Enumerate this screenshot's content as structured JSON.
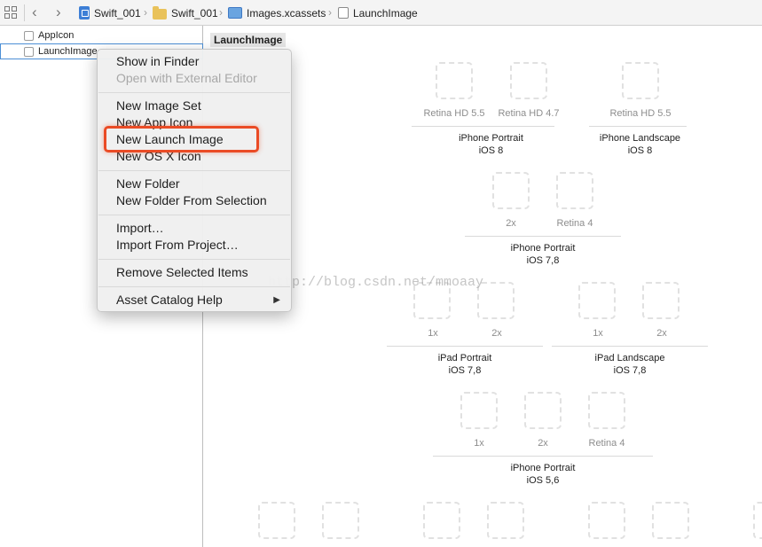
{
  "jumpbar": {
    "crumbs": [
      "Swift_001",
      "Swift_001",
      "Images.xcassets",
      "LaunchImage"
    ],
    "icons": [
      "grid-icon",
      "back-arrow-icon",
      "forward-arrow-icon",
      "project-file-icon",
      "folder-icon",
      "asset-catalog-icon",
      "launch-image-icon"
    ]
  },
  "outline": {
    "items": [
      "AppIcon",
      "LaunchImage"
    ]
  },
  "main": {
    "set_title": "LaunchImage",
    "slots": [
      "Retina HD 5.5",
      "Retina HD 4.7",
      "Retina HD 5.5",
      "2x",
      "Retina 4",
      "1x",
      "2x",
      "1x",
      "2x",
      "1x",
      "2x",
      "Retina 4"
    ],
    "groups": [
      {
        "name": "iPhone Portrait",
        "os": "iOS 8"
      },
      {
        "name": "iPhone Landscape",
        "os": "iOS 8"
      },
      {
        "name": "iPhone Portrait",
        "os": "iOS 7,8"
      },
      {
        "name": "iPad Portrait",
        "os": "iOS 7,8"
      },
      {
        "name": "iPad Landscape",
        "os": "iOS 7,8"
      },
      {
        "name": "iPhone Portrait",
        "os": "iOS 5,6"
      }
    ]
  },
  "menu": {
    "items": [
      "Show in Finder",
      "Open with External Editor",
      "New Image Set",
      "New App Icon",
      "New Launch Image",
      "New OS X Icon",
      "New Folder",
      "New Folder From Selection",
      "Import…",
      "Import From Project…",
      "Remove Selected Items",
      "Asset Catalog Help"
    ],
    "submenu_arrow": "▶",
    "highlight_color": "#ea4b25"
  },
  "watermark": "http://blog.csdn.net/mmoaay"
}
